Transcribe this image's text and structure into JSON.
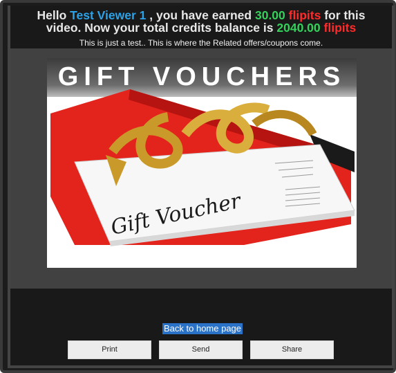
{
  "header": {
    "hello": "Hello",
    "user_name": "Test Viewer 1",
    "earned_text": ", you have earned",
    "earned_amount": "30.00",
    "currency": "flipits",
    "for_this": "for this",
    "line2_text": "video. Now your total credits balance is",
    "balance": "2040.00",
    "currency2": "flipits"
  },
  "subtitle": "This is just a test.. This is where the Related offers/coupons come.",
  "offer": {
    "title": "GIFT VOUCHERS",
    "script_text": "Gift Voucher"
  },
  "footer": {
    "home_link": "Back to home page",
    "buttons": [
      "Print",
      "Send",
      "Share"
    ]
  },
  "colors": {
    "name": "#2aa3ea",
    "amount": "#35d15b",
    "currency": "#ff2a2a",
    "link_bg": "#2a72c8"
  }
}
